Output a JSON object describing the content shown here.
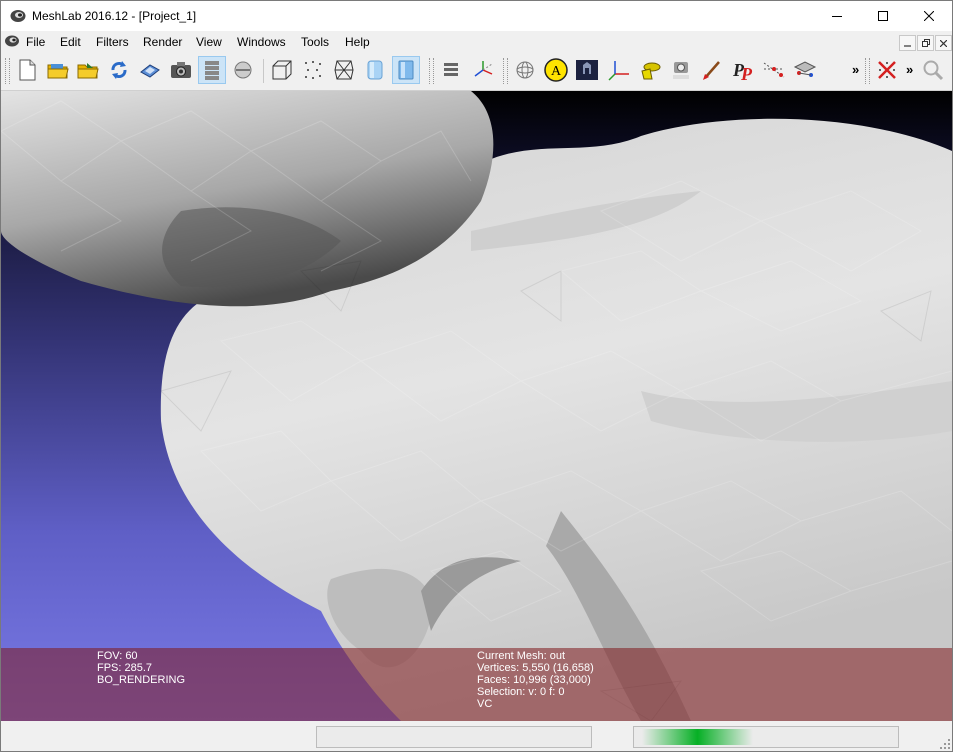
{
  "window": {
    "title": "MeshLab 2016.12 - [Project_1]"
  },
  "menubar": {
    "items": [
      {
        "label": "File"
      },
      {
        "label": "Edit"
      },
      {
        "label": "Filters"
      },
      {
        "label": "Render"
      },
      {
        "label": "View"
      },
      {
        "label": "Windows"
      },
      {
        "label": "Tools"
      },
      {
        "label": "Help"
      }
    ]
  },
  "toolbar": {
    "buttons": [
      {
        "icon": "new-project-icon"
      },
      {
        "icon": "open-project-icon"
      },
      {
        "icon": "import-mesh-icon"
      },
      {
        "icon": "reload-icon"
      },
      {
        "icon": "export-mesh-icon"
      },
      {
        "icon": "snapshot-icon"
      },
      {
        "icon": "layers-icon",
        "active": true
      },
      {
        "icon": "raster-icon"
      },
      {
        "icon": "bounding-box-icon"
      },
      {
        "icon": "points-icon"
      },
      {
        "icon": "wireframe-icon"
      },
      {
        "icon": "flat-shading-icon"
      },
      {
        "icon": "smooth-shading-icon",
        "active": true
      },
      {
        "icon": "layer-stack-icon"
      },
      {
        "icon": "axes-icon"
      },
      {
        "icon": "trackball-icon"
      },
      {
        "icon": "annotation-icon",
        "label": "A"
      },
      {
        "icon": "texture-icon"
      },
      {
        "icon": "coordinate-frame-icon"
      },
      {
        "icon": "paint-brush-icon"
      },
      {
        "icon": "raster-alignment-icon"
      },
      {
        "icon": "paint-icon"
      },
      {
        "icon": "pickpoints-icon",
        "label": "P"
      },
      {
        "icon": "measure-icon"
      },
      {
        "icon": "align-icon"
      },
      {
        "icon": "delete-selection-icon"
      },
      {
        "icon": "zoom-icon"
      }
    ],
    "more_label": "»"
  },
  "viewport": {
    "info_left": {
      "fov": "FOV: 60",
      "fps": "FPS:   285.7",
      "mode": "BO_RENDERING"
    },
    "info_right": {
      "current_mesh": "Current Mesh: out",
      "vertices": "Vertices: 5,550    (16,658)",
      "faces": "Faces: 10,996    (33,000)",
      "selection": "Selection: v: 0 f: 0",
      "vc": "VC"
    }
  },
  "statusbar": {
    "progress_fraction": 0.42,
    "colors": {
      "progress": "#06b025"
    }
  }
}
